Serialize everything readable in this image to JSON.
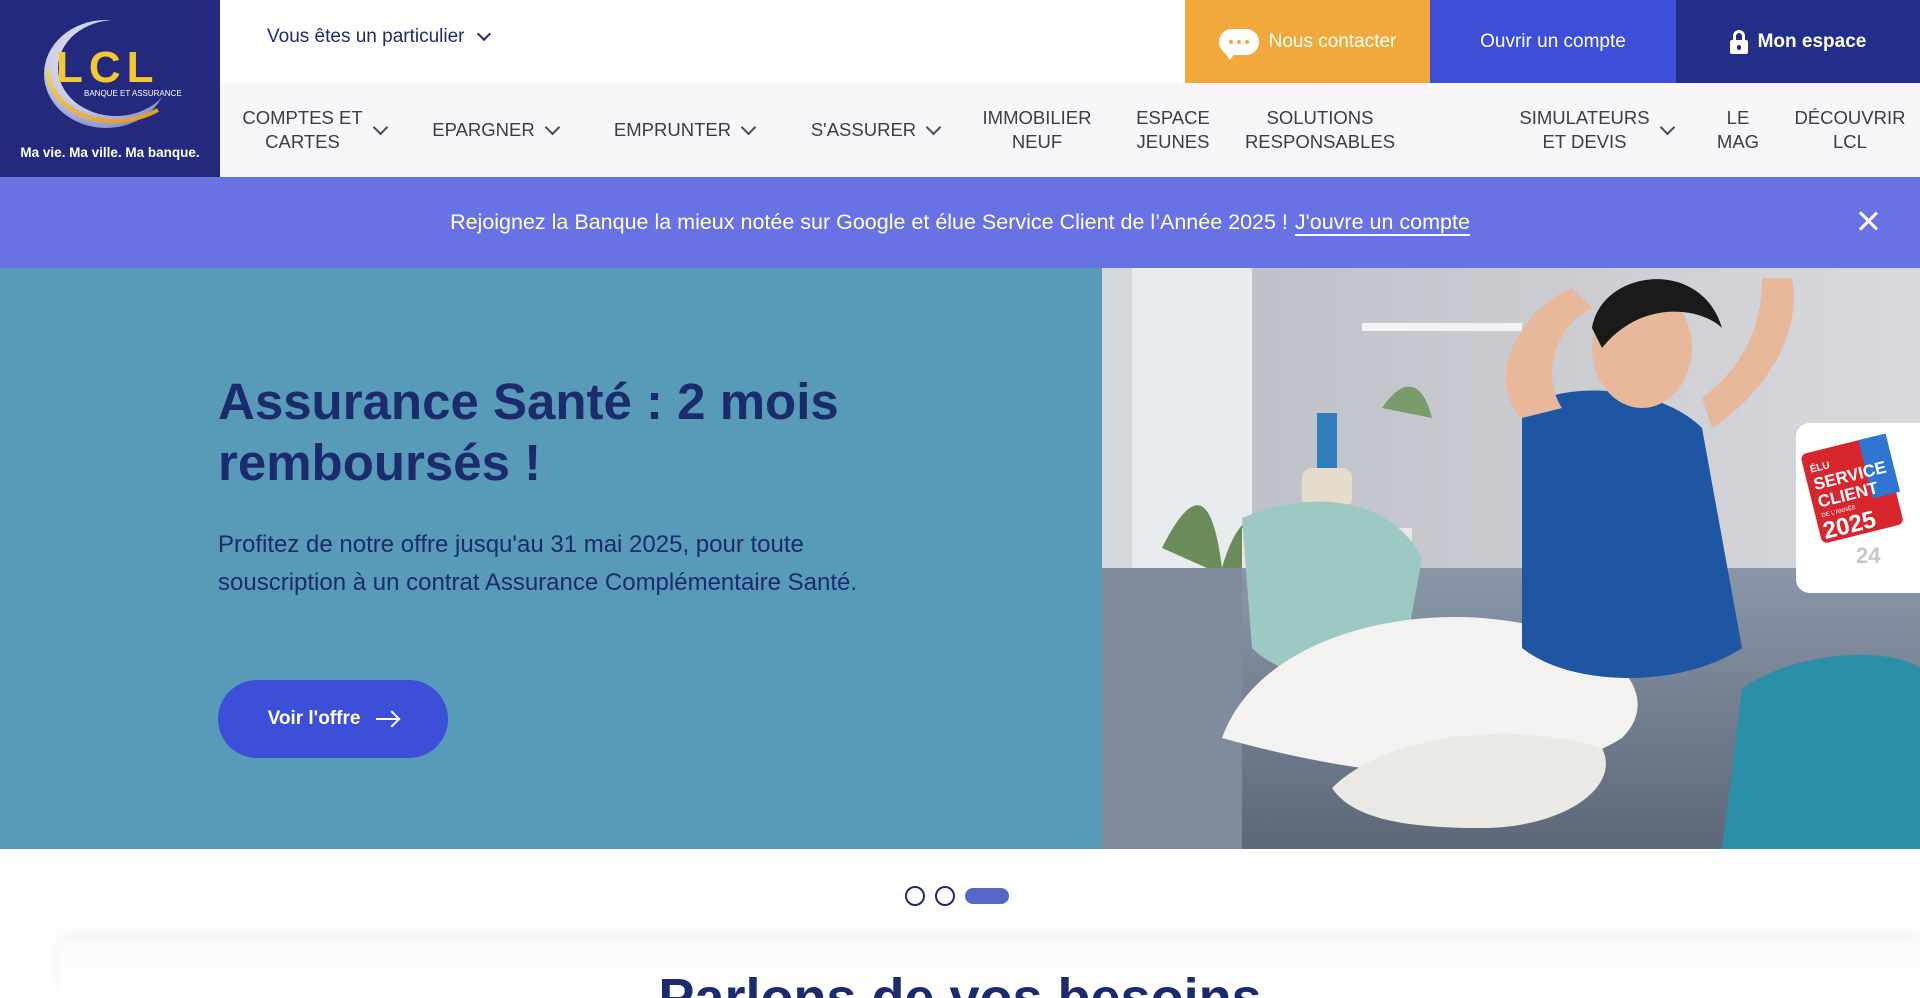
{
  "brand": {
    "logo_text": "LCL",
    "logo_subtext": "BANQUE ET ASSURANCE",
    "tagline": "Ma vie. Ma ville. Ma banque.",
    "colors": {
      "navy": "#232a7d",
      "orange": "#f1a93b",
      "blue": "#3d4fd8",
      "dark_blue": "#232d8a",
      "promo": "#6872e4",
      "hero_bg": "#589bb8"
    }
  },
  "topbar": {
    "profile_label": "Vous êtes un particulier",
    "contact_label": "Nous contacter",
    "open_account_label": "Ouvrir un compte",
    "my_space_label": "Mon espace"
  },
  "nav": {
    "items": [
      {
        "label": "COMPTES ET\nCARTES",
        "has_dropdown": true
      },
      {
        "label": "EPARGNER",
        "has_dropdown": true
      },
      {
        "label": "EMPRUNTER",
        "has_dropdown": true
      },
      {
        "label": "S'ASSURER",
        "has_dropdown": true
      },
      {
        "label": "IMMOBILIER\nNEUF",
        "has_dropdown": false
      },
      {
        "label": "ESPACE\nJEUNES",
        "has_dropdown": false
      },
      {
        "label": "SOLUTIONS\nRESPONSABLES",
        "has_dropdown": false
      },
      {
        "label": "SIMULATEURS\nET DEVIS",
        "has_dropdown": true
      },
      {
        "label": "LE\nMAG",
        "has_dropdown": false
      },
      {
        "label": "DÉCOUVRIR\nLCL",
        "has_dropdown": false
      }
    ]
  },
  "promo": {
    "text": "Rejoignez la Banque la mieux notée sur Google et élue Service Client de l’Année 2025 !",
    "link": "J'ouvre un compte"
  },
  "hero": {
    "title": "Assurance Santé : 2 mois remboursés !",
    "text": "Profitez de notre offre jusqu'au 31 mai 2025, pour toute souscription à un contrat Assurance Complémentaire Santé.",
    "cta": "Voir l'offre",
    "badge": {
      "line1": "ÉLU",
      "line2": "SERVICE",
      "line3": "CLIENT",
      "line4": "DE L'ANNÉE",
      "year": "2025",
      "prev_years": "24"
    }
  },
  "carousel": {
    "count": 3,
    "active_index": 2
  },
  "section": {
    "title": "Parlons de vos besoins"
  }
}
